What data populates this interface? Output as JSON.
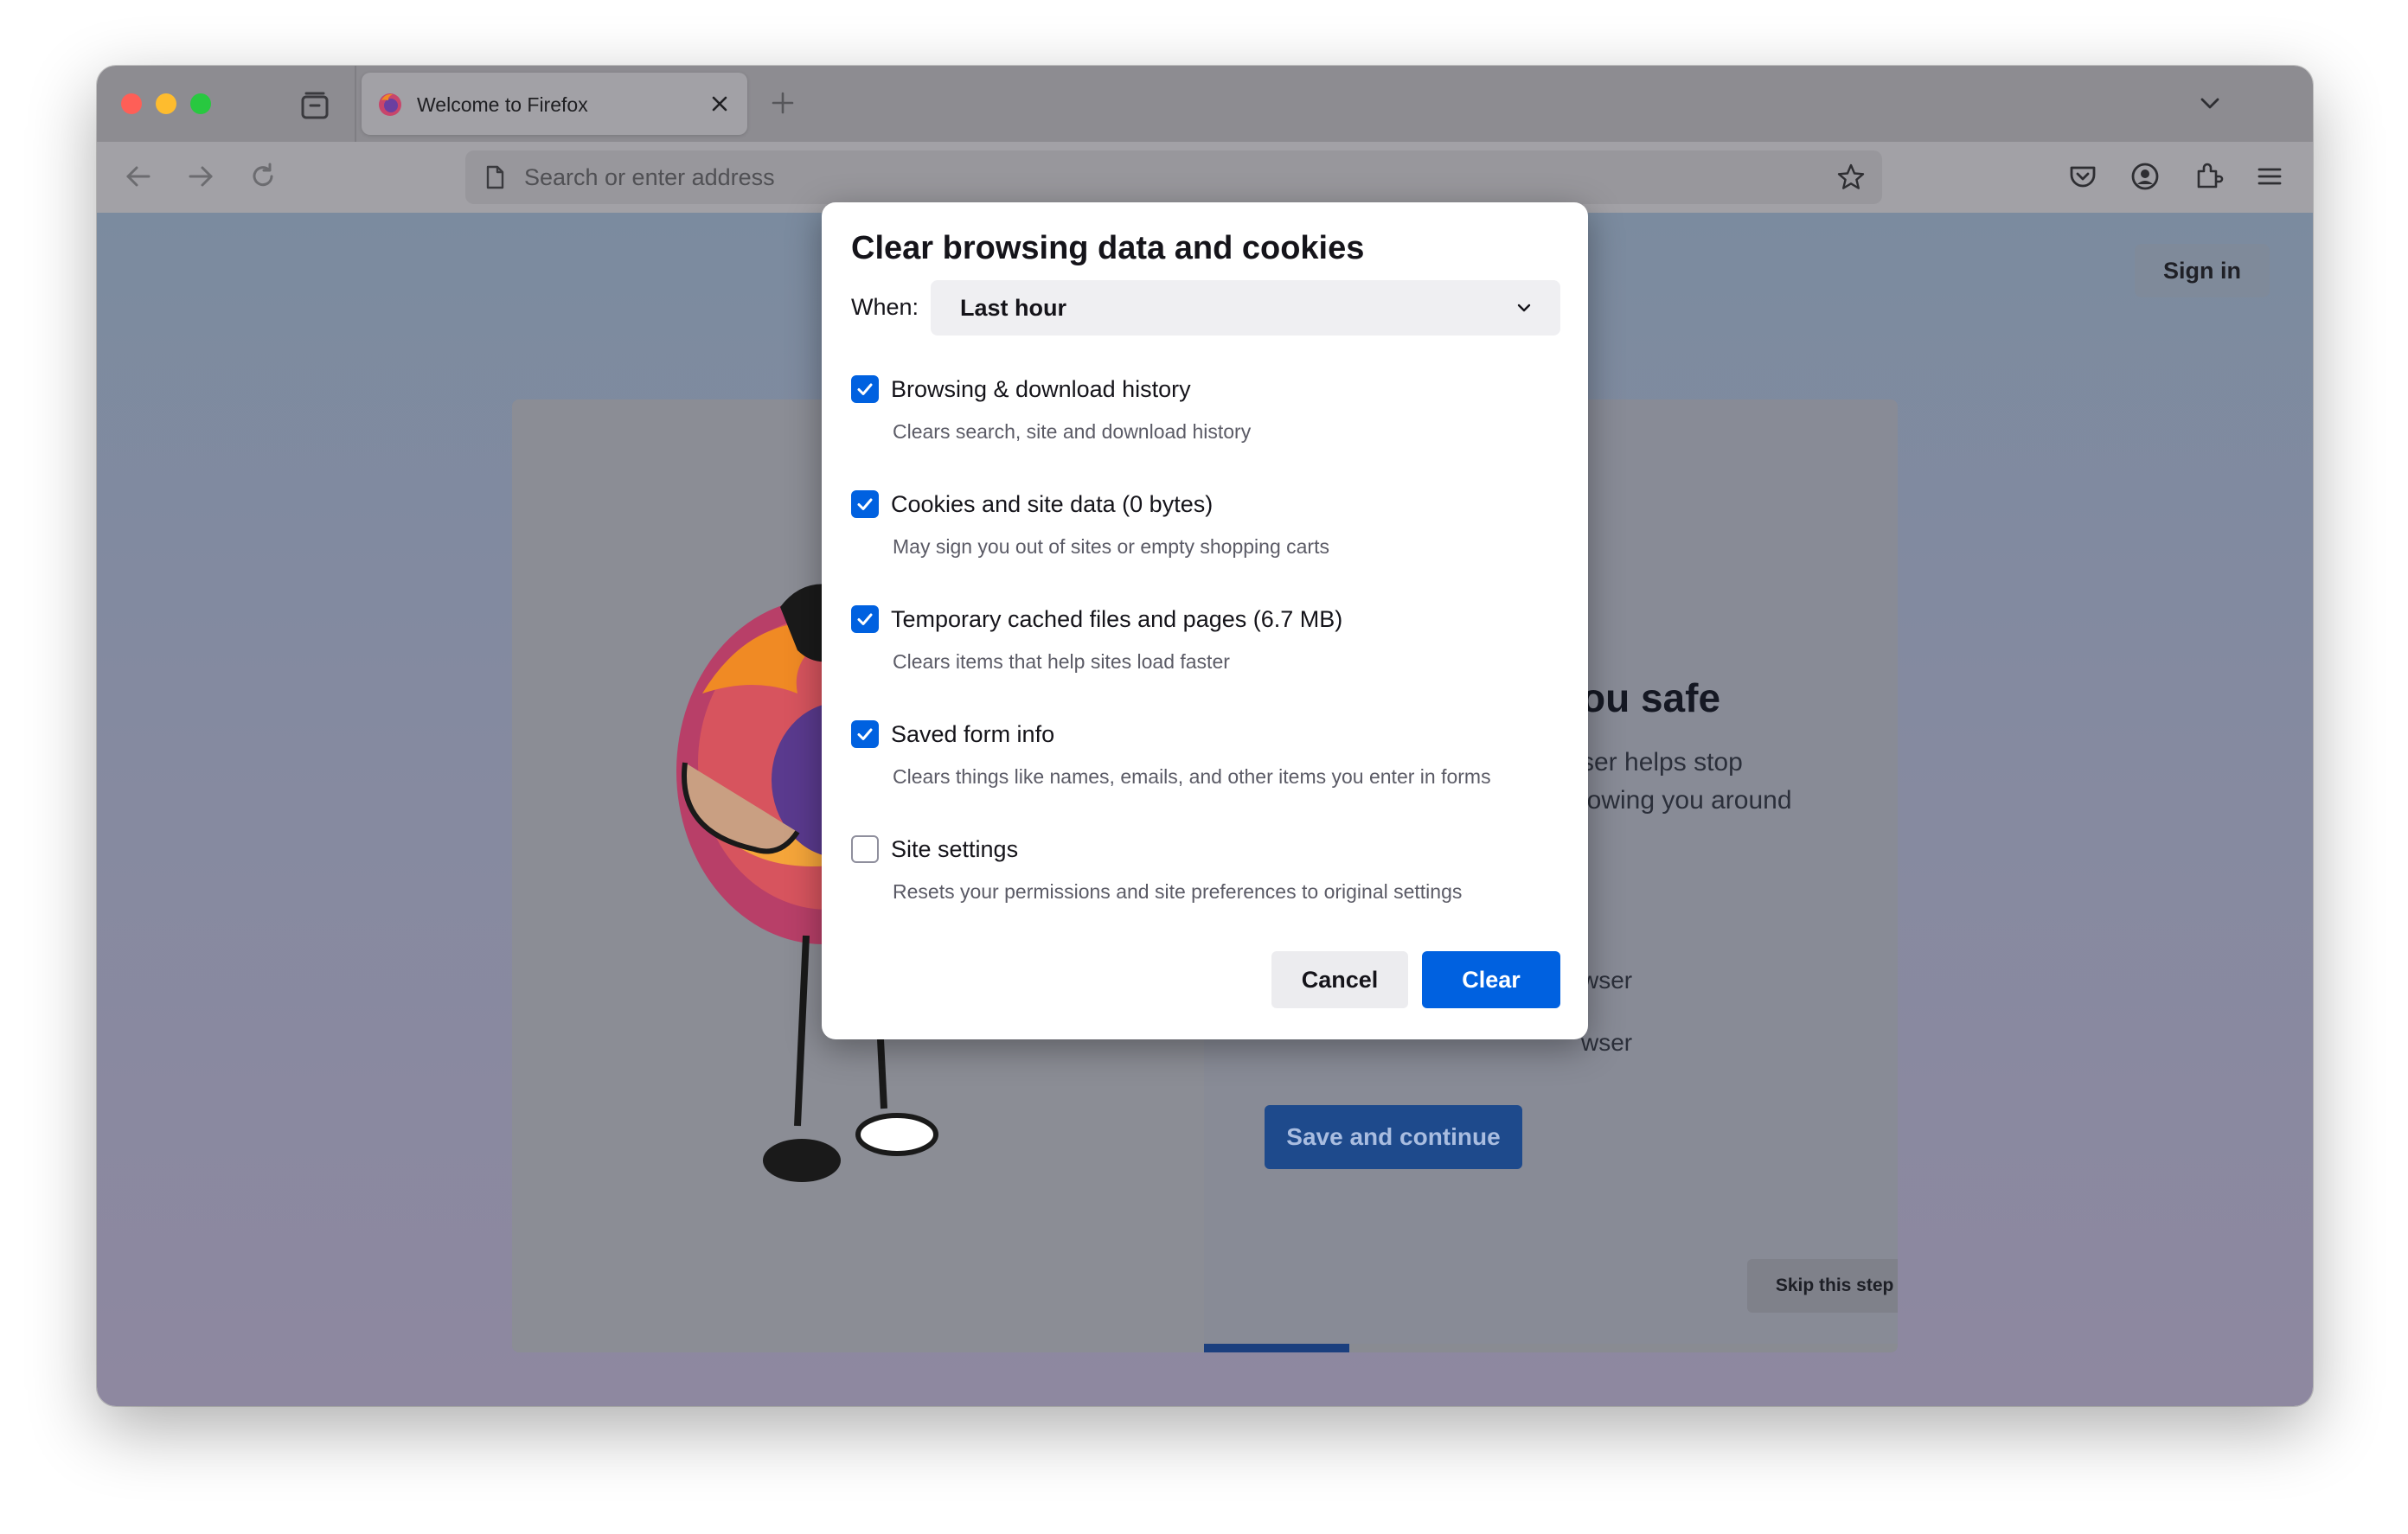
{
  "browser": {
    "tab": {
      "title": "Welcome to Firefox"
    },
    "urlbar": {
      "placeholder": "Search or enter address"
    }
  },
  "page": {
    "sign_in_label": "Sign in",
    "heading_fragment": "ou safe",
    "text_line_1": "ser helps stop",
    "text_line_2": "lowing you around",
    "option_1_fragment": "wser",
    "option_2_fragment": "wser",
    "save_continue_label": "Save and continue",
    "skip_label": "Skip this step",
    "progress_fraction": 0.21
  },
  "dialog": {
    "title": "Clear browsing data and cookies",
    "when_label": "When:",
    "when_value": "Last hour",
    "options": [
      {
        "label": "Browsing & download history",
        "description": "Clears search, site and download history",
        "checked": true
      },
      {
        "label": "Cookies and site data (0 bytes)",
        "description": "May sign you out of sites or empty shopping carts",
        "checked": true
      },
      {
        "label": "Temporary cached files and pages (6.7 MB)",
        "description": "Clears items that help sites load faster",
        "checked": true
      },
      {
        "label": "Saved form info",
        "description": "Clears things like names, emails, and other items you enter in forms",
        "checked": true
      },
      {
        "label": "Site settings",
        "description": "Resets your permissions and site preferences to original settings",
        "checked": false
      }
    ],
    "cancel_label": "Cancel",
    "clear_label": "Clear"
  },
  "colors": {
    "accent": "#0061e0",
    "progress": "#1b3f7e"
  }
}
